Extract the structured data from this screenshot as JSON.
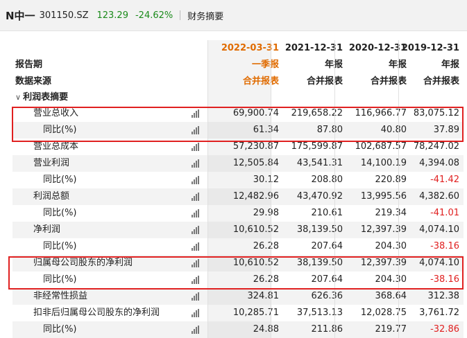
{
  "header": {
    "name": "N中一",
    "code": "301150.SZ",
    "price": "123.29",
    "change": "-24.62%",
    "title": "财务摘要"
  },
  "columns": [
    {
      "date": "2022-03-31",
      "period": "一季报",
      "source": "合并报表"
    },
    {
      "date": "2021-12-31",
      "period": "年报",
      "source": "合并报表"
    },
    {
      "date": "2020-12-31",
      "period": "年报",
      "source": "合并报表"
    },
    {
      "date": "2019-12-31",
      "period": "年报",
      "source": "合并报表"
    }
  ],
  "labels": {
    "period": "报告期",
    "source": "数据来源",
    "section": "利润表摘要",
    "section_toggle": "∨"
  },
  "rows": [
    {
      "label": "营业总收入",
      "values": [
        "69,900.74",
        "219,658.22",
        "116,966.77",
        "83,075.12"
      ],
      "indent": 1
    },
    {
      "label": "同比(%)",
      "values": [
        "61.34",
        "87.80",
        "40.80",
        "37.89"
      ],
      "indent": 2
    },
    {
      "label": "营业总成本",
      "values": [
        "57,230.87",
        "175,599.87",
        "102,687.57",
        "78,247.02"
      ],
      "indent": 1
    },
    {
      "label": "营业利润",
      "values": [
        "12,505.84",
        "43,541.31",
        "14,100.19",
        "4,394.08"
      ],
      "indent": 1
    },
    {
      "label": "同比(%)",
      "values": [
        "30.12",
        "208.80",
        "220.89",
        "-41.42"
      ],
      "indent": 2
    },
    {
      "label": "利润总额",
      "values": [
        "12,482.96",
        "43,470.92",
        "13,995.56",
        "4,382.60"
      ],
      "indent": 1
    },
    {
      "label": "同比(%)",
      "values": [
        "29.98",
        "210.61",
        "219.34",
        "-41.01"
      ],
      "indent": 2
    },
    {
      "label": "净利润",
      "values": [
        "10,610.52",
        "38,139.50",
        "12,397.39",
        "4,074.10"
      ],
      "indent": 1
    },
    {
      "label": "同比(%)",
      "values": [
        "26.28",
        "207.64",
        "204.30",
        "-38.16"
      ],
      "indent": 2
    },
    {
      "label": "归属母公司股东的净利润",
      "values": [
        "10,610.52",
        "38,139.50",
        "12,397.39",
        "4,074.10"
      ],
      "indent": 1
    },
    {
      "label": "同比(%)",
      "values": [
        "26.28",
        "207.64",
        "204.30",
        "-38.16"
      ],
      "indent": 2
    },
    {
      "label": "非经常性损益",
      "values": [
        "324.81",
        "626.36",
        "368.64",
        "312.38"
      ],
      "indent": 1
    },
    {
      "label": "扣非后归属母公司股东的净利润",
      "values": [
        "10,285.71",
        "37,513.13",
        "12,028.75",
        "3,761.72"
      ],
      "indent": 1
    },
    {
      "label": "同比(%)",
      "values": [
        "24.88",
        "211.86",
        "219.77",
        "-32.86"
      ],
      "indent": 2
    }
  ],
  "colors": {
    "accent_orange": "#e06b00",
    "negative_red": "#e02020",
    "positive_green": "#1a8a1a",
    "highlight_box": "#e02020"
  }
}
